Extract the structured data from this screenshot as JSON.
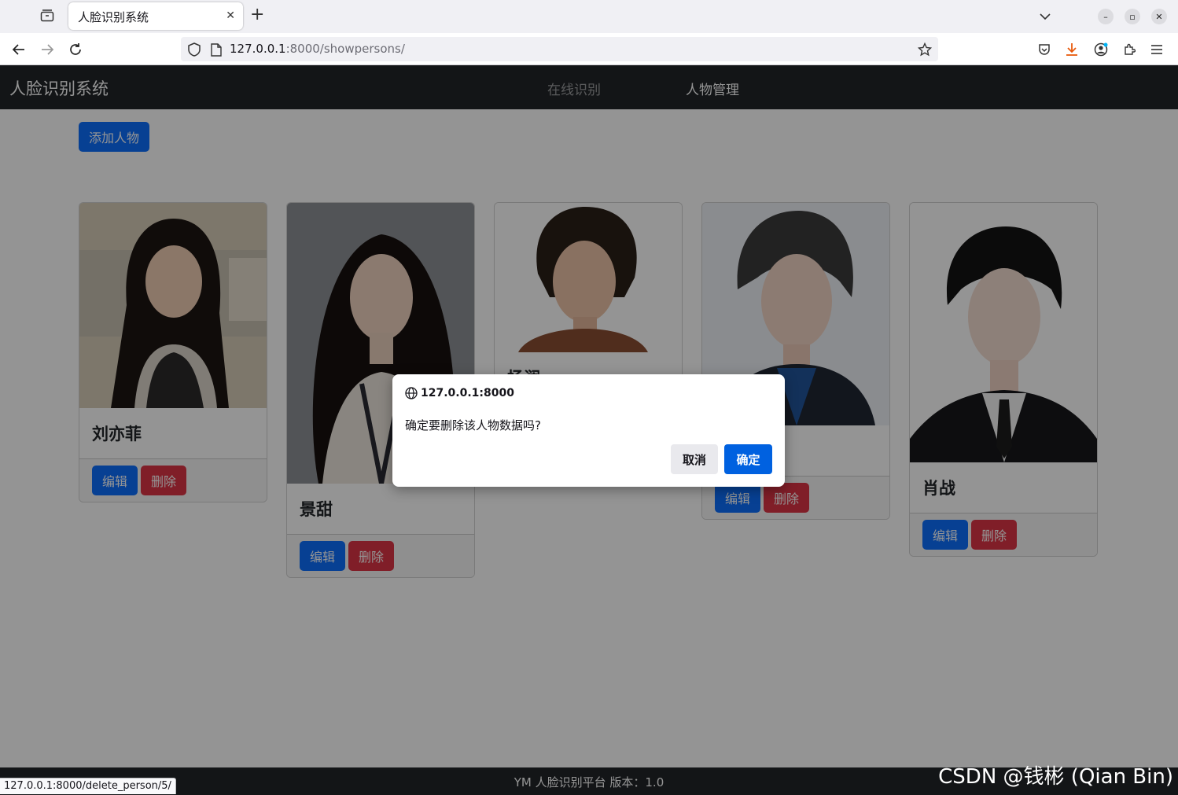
{
  "browser": {
    "tab_title": "人脸识别系统",
    "url_host": "127.0.0.1",
    "url_rest": ":8000/showpersons/",
    "status_url": "127.0.0.1:8000/delete_person/5/"
  },
  "site": {
    "brand": "人脸识别系统",
    "nav": [
      {
        "label": "在线识别"
      },
      {
        "label": "人物管理"
      }
    ],
    "add_button": "添加人物",
    "edit_label": "编辑",
    "delete_label": "删除",
    "footer": "YM 人脸识别平台   版本：1.0"
  },
  "persons": [
    {
      "name": "刘亦菲"
    },
    {
      "name": "景甜"
    },
    {
      "name": "杨澜"
    },
    {
      "name": ""
    },
    {
      "name": "肖战"
    }
  ],
  "dialog": {
    "origin": "127.0.0.1:8000",
    "message": "确定要删除该人物数据吗?",
    "cancel": "取消",
    "ok": "确定"
  },
  "watermark": "CSDN @钱彬 (Qian Bin)",
  "colors": {
    "primary": "#0d6efd",
    "danger": "#dc3545",
    "navbar": "#212529",
    "dialog_ok": "#0061e0"
  }
}
